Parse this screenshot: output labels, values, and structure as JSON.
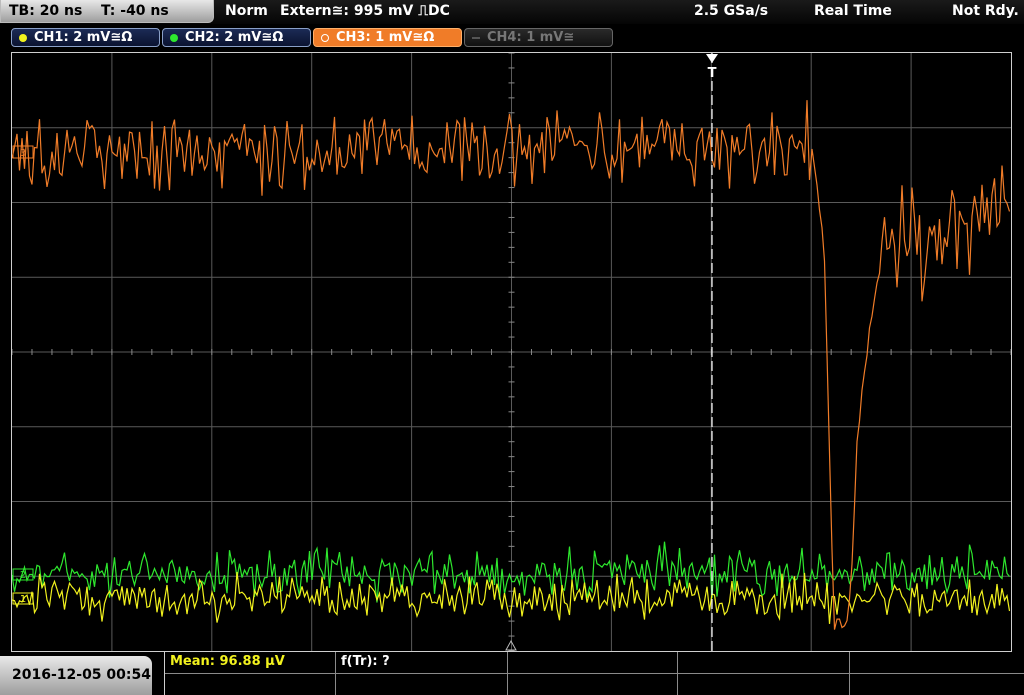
{
  "topbar": {
    "timebase": "TB: 20 ns",
    "trigger_offset": "T: -40 ns",
    "trigger_mode": "Norm",
    "trigger_source": "Extern≅: 995 mV ⎍DC",
    "sample_rate": "2.5 GSa/s",
    "acq_mode": "Real Time",
    "status": "Not Rdy."
  },
  "channels": [
    {
      "label": "CH1: 2 mV≅Ω",
      "color": "#f2f21e",
      "state": "on"
    },
    {
      "label": "CH2: 2 mV≅Ω",
      "color": "#2ee82e",
      "state": "on"
    },
    {
      "label": "CH3: 1 mV≅Ω",
      "color": "#f07c28",
      "state": "selected"
    },
    {
      "label": "CH4: 1 mV≅",
      "color": "#777777",
      "state": "off"
    }
  ],
  "screen": {
    "trigger_marker": "T",
    "ch3_marker": "3",
    "ch2_marker": "2",
    "ch1_marker": "1"
  },
  "bottom": {
    "datetime": "2016-12-05 00:54",
    "mean_label": "Mean: 96.88 µV",
    "ftr_label": "f(Tr): ?"
  },
  "colors": {
    "ch1": "#f2f21e",
    "ch2": "#2ee82e",
    "ch3": "#f07c28",
    "grid": "#5a5a5a",
    "trigger": "#ffffff"
  }
}
